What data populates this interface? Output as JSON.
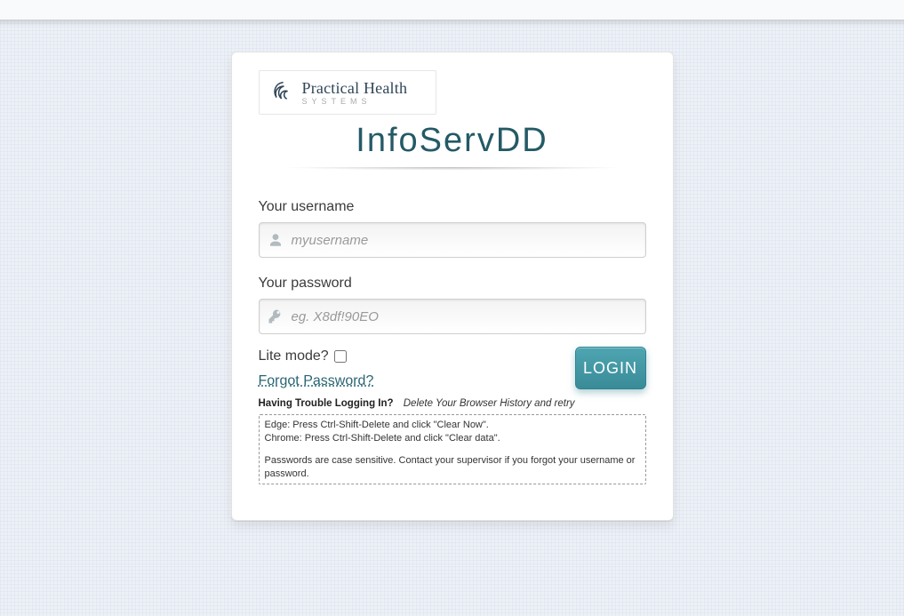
{
  "brand": {
    "line1": "Practical Health",
    "line2": "SYSTEMS"
  },
  "app_title": "InfoServDD",
  "form": {
    "username": {
      "label": "Your username",
      "placeholder": "myusername",
      "value": ""
    },
    "password": {
      "label": "Your password",
      "placeholder": "eg. X8df!90EO",
      "value": ""
    },
    "lite_mode": {
      "label": "Lite mode?",
      "checked": false
    },
    "login_button": "LOGIN",
    "forgot_password": "Forgot Password?"
  },
  "help": {
    "trouble_label": "Having Trouble Logging In?",
    "trouble_tip": "Delete Your Browser History and retry",
    "lines": {
      "edge": "Edge: Press Ctrl-Shift-Delete and click \"Clear Now\".",
      "chrome": "Chrome: Press Ctrl-Shift-Delete and click \"Clear data\".",
      "pw": "Passwords are case sensitive. Contact your supervisor if you forgot your username or password."
    }
  }
}
